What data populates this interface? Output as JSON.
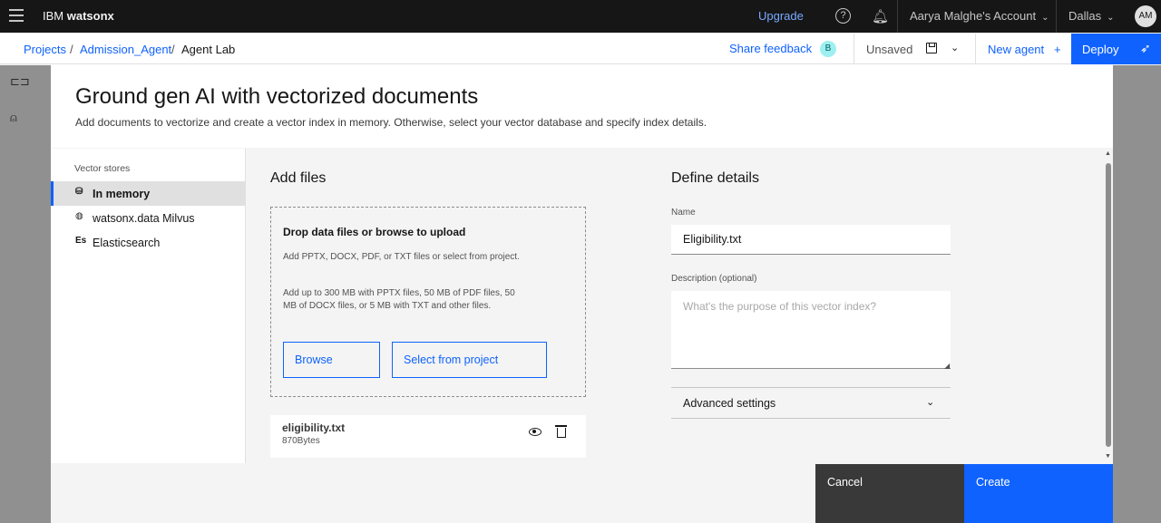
{
  "header": {
    "brand_light": "IBM",
    "brand_bold": "watsonx",
    "upgrade": "Upgrade",
    "account": "Aarya Malghe's Account",
    "region": "Dallas",
    "avatar": "AM"
  },
  "subbar": {
    "breadcrumbs": [
      "Projects",
      "Admission_Agent",
      "Agent Lab"
    ],
    "separator": "/",
    "share_feedback": "Share feedback",
    "badge": "B",
    "unsaved": "Unsaved",
    "new_agent": "New agent",
    "new_agent_icon": "+",
    "deploy": "Deploy"
  },
  "modal": {
    "title": "Ground gen AI with vectorized documents",
    "subtitle": "Add documents to vectorize and create a vector index in memory. Otherwise, select your vector database and specify index details.",
    "nav": {
      "title": "Vector stores",
      "items": [
        {
          "icon": "memory-icon",
          "glyph": "⛁",
          "label": "In memory",
          "active": true
        },
        {
          "icon": "milvus-icon",
          "glyph": "◍",
          "label": "watsonx.data Milvus",
          "active": false
        },
        {
          "icon": "elasticsearch-icon",
          "glyph": "Es",
          "label": "Elasticsearch",
          "active": false
        }
      ]
    },
    "add_files": {
      "heading": "Add files",
      "drop_title": "Drop data files or browse to upload",
      "drop_text_1": "Add PPTX, DOCX, PDF, or TXT files or select from project.",
      "drop_text_2": "Add up to 300 MB with PPTX files, 50 MB of PDF files, 50 MB of DOCX files, or 5 MB with TXT and other files.",
      "browse": "Browse",
      "select_from_project": "Select from project",
      "file": {
        "name": "eligibility.txt",
        "size": "870Bytes"
      }
    },
    "details": {
      "heading": "Define details",
      "name_label": "Name",
      "name_value": "Eligibility.txt",
      "description_label": "Description (optional)",
      "description_placeholder": "What's the purpose of this vector index?",
      "advanced_settings": "Advanced settings"
    },
    "footer": {
      "cancel": "Cancel",
      "create": "Create"
    }
  }
}
